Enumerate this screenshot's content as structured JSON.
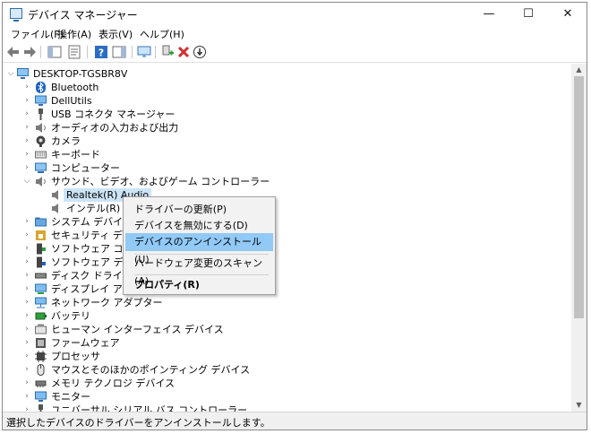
{
  "window": {
    "title": "デバイス マネージャー",
    "minimize": "—",
    "maximize": "☐",
    "close": "✕"
  },
  "menu": [
    "ファイル(F)",
    "操作(A)",
    "表示(V)",
    "ヘルプ(H)"
  ],
  "tree": {
    "root": "DESKTOP-TGSBR8V",
    "categories": [
      {
        "label": "Bluetooth",
        "icon": "bluetooth-icon"
      },
      {
        "label": "DellUtils",
        "icon": "monitor-icon"
      },
      {
        "label": "USB コネクタ マネージャー",
        "icon": "usb-icon"
      },
      {
        "label": "オーディオの入力および出力",
        "icon": "speaker-icon"
      },
      {
        "label": "カメラ",
        "icon": "camera-icon"
      },
      {
        "label": "キーボード",
        "icon": "keyboard-icon"
      },
      {
        "label": "コンピューター",
        "icon": "computer-icon"
      },
      {
        "label": "サウンド、ビデオ、およびゲーム コントローラー",
        "icon": "speaker-icon"
      },
      {
        "label": "Realtek(R) Audio",
        "icon": "speaker-icon"
      },
      {
        "label": "インテル(R) デ",
        "icon": "speaker-icon"
      },
      {
        "label": "システム デバイス",
        "icon": "folder-icon"
      },
      {
        "label": "セキュリティ デバイ",
        "icon": "security-icon"
      },
      {
        "label": "ソフトウェア コンポ",
        "icon": "software-icon"
      },
      {
        "label": "ソフトウェア デバイ",
        "icon": "software-icon"
      },
      {
        "label": "ディスク ドライブ",
        "icon": "disk-icon"
      },
      {
        "label": "ディスプレイ アダプ",
        "icon": "monitor-icon"
      },
      {
        "label": "ネットワーク アダプター",
        "icon": "network-icon"
      },
      {
        "label": "バッテリ",
        "icon": "battery-icon"
      },
      {
        "label": "ヒューマン インターフェイス デバイス",
        "icon": "hid-icon"
      },
      {
        "label": "ファームウェア",
        "icon": "firmware-icon"
      },
      {
        "label": "プロセッサ",
        "icon": "processor-icon"
      },
      {
        "label": "マウスとそのほかのポインティング デバイス",
        "icon": "mouse-icon"
      },
      {
        "label": "メモリ テクノロジ デバイス",
        "icon": "memory-icon"
      },
      {
        "label": "モニター",
        "icon": "monitor-icon"
      },
      {
        "label": "ユニバーサル シリアル バス コントローラー",
        "icon": "usb-icon"
      }
    ]
  },
  "context_menu": {
    "items": [
      "ドライバーの更新(P)",
      "デバイスを無効にする(D)",
      "デバイスのアンインストール(U)",
      "ハードウェア変更のスキャン(A)",
      "プロパティ(R)"
    ],
    "highlighted_index": 2
  },
  "status": "選択したデバイスのドライバーをアンインストールします。",
  "colors": {
    "selection": "#cce4f7",
    "menu_highlight": "#91c9f7",
    "delete_red": "#d32f2f",
    "enable_green": "#2e9e3a"
  }
}
